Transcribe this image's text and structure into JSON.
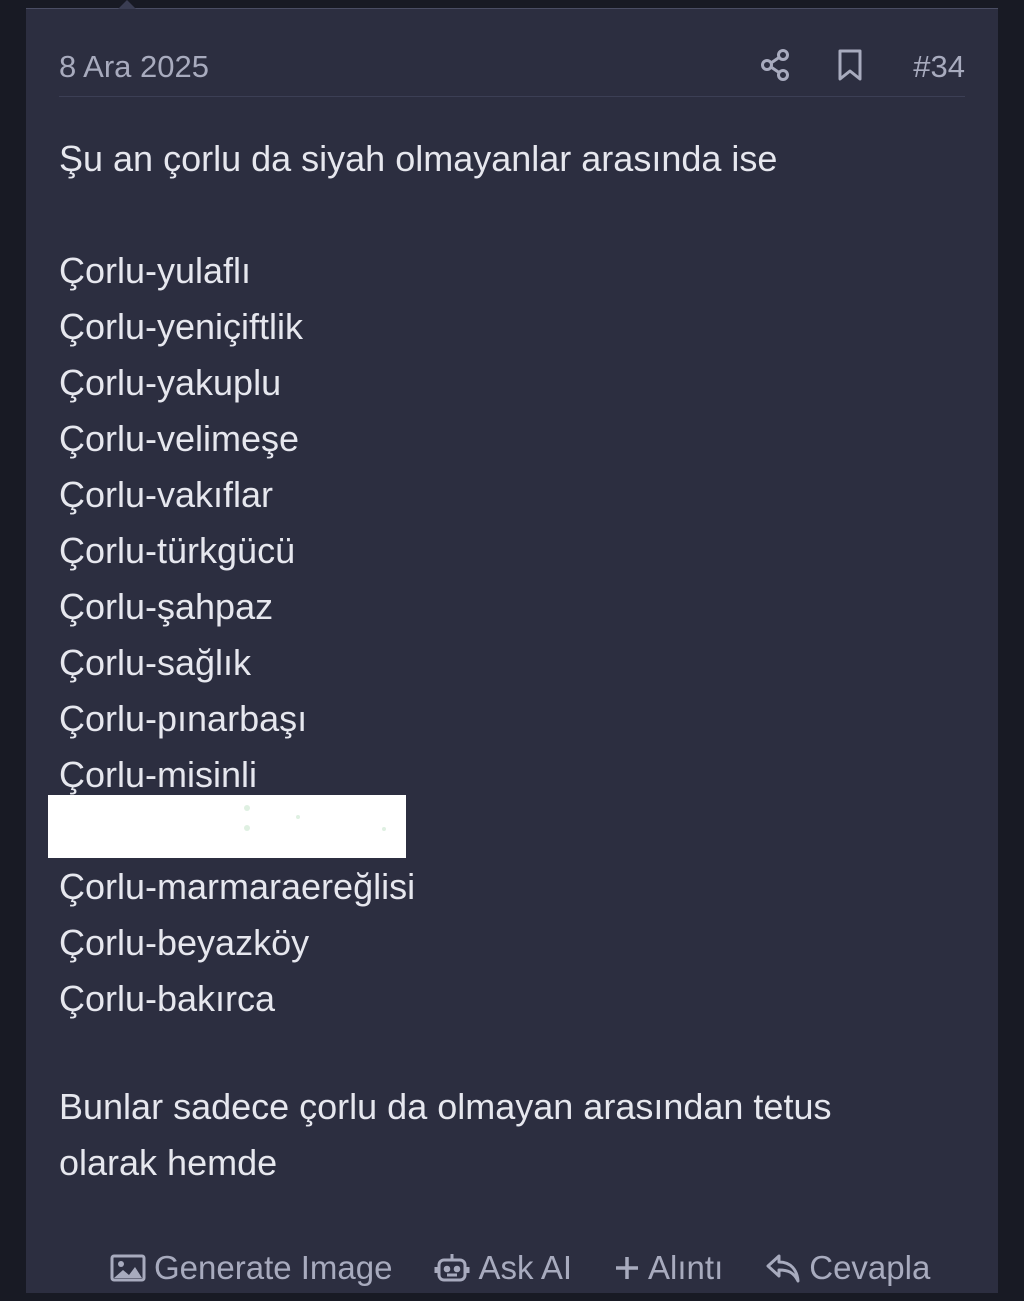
{
  "post": {
    "date": "8 Ara 2025",
    "number": "#34",
    "intro": "Şu an çorlu da siyah olmayanlar arasında ise",
    "items": [
      "Çorlu-yulaflı",
      "Çorlu-yeniçiftlik",
      "Çorlu-yakuplu",
      "Çorlu-velimeşe",
      "Çorlu-vakıflar",
      "Çorlu-türkgücü",
      "Çorlu-şahpaz",
      "Çorlu-sağlık",
      "Çorlu-pınarbaşı",
      "Çorlu-misinli",
      "Çorlu-marmaraereğlisi",
      "Çorlu-beyazköy",
      "Çorlu-bakırca"
    ],
    "closing_line1": "Bunlar sadece çorlu da olmayan arasından tetus",
    "closing_line2": "olarak hemde"
  },
  "actions": {
    "generate_image": "Generate Image",
    "ask_ai": "Ask AI",
    "quote": "Alıntı",
    "reply": "Cevapla"
  },
  "icons": {
    "share": "share-icon",
    "bookmark": "bookmark-icon",
    "image": "image-icon",
    "robot": "robot-icon",
    "plus": "plus-icon",
    "reply": "reply-icon"
  },
  "colors": {
    "background": "#181a24",
    "card": "#2c2e40",
    "text": "#e6e7ee",
    "muted": "#a8abbe"
  }
}
